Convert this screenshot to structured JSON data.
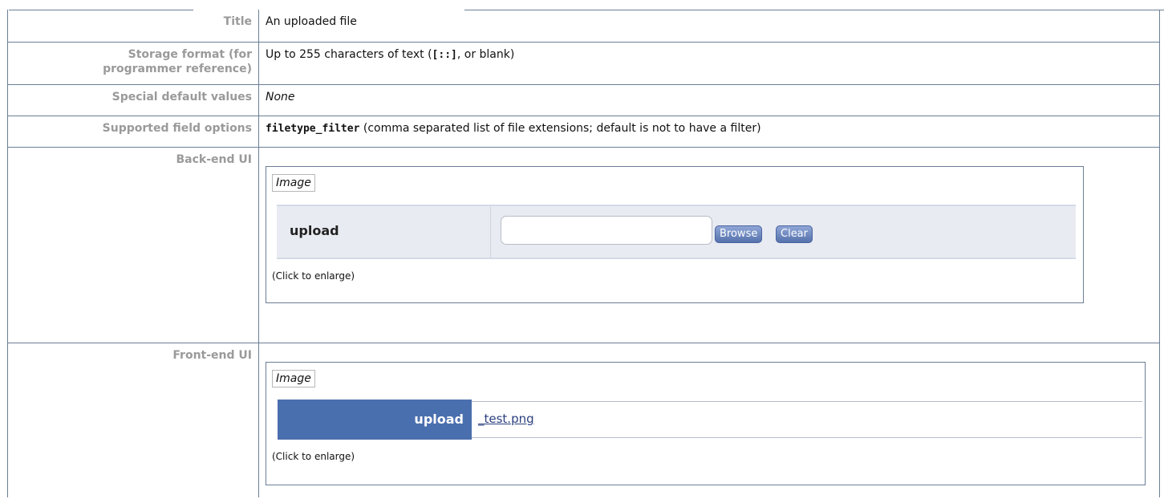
{
  "rows": {
    "title": {
      "label": "Title",
      "value": "An uploaded file"
    },
    "storage": {
      "label_line1": "Storage format (for",
      "label_line2": "programmer reference)",
      "value_before": "Up to 255 characters of text (",
      "value_code": "[::]",
      "value_after": ", or blank)"
    },
    "defaults": {
      "label": "Special default values",
      "value": "None"
    },
    "options": {
      "label": "Supported field options",
      "value_code": "filetype_filter",
      "value_after": " (comma separated list of file extensions; default is not to have a filter)"
    },
    "backend": {
      "label": "Back-end UI",
      "caption": "Image",
      "click": "(Click to enlarge)",
      "field_label": "upload",
      "browse_label": "Browse",
      "clear_label": "Clear"
    },
    "frontend": {
      "label": "Front-end UI",
      "caption": "Image",
      "click": "(Click to enlarge)",
      "field_label": "upload",
      "file_link": "_test.png"
    }
  },
  "colors": {
    "border": "#6b7e95",
    "label_text": "#9a9a9a",
    "button": "#5572ad",
    "frontend_label_bg": "#4a6fae"
  }
}
